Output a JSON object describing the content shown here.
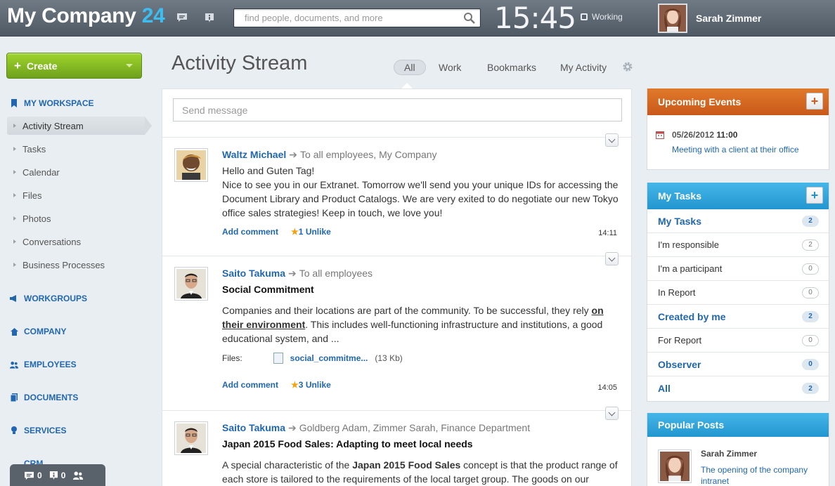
{
  "header": {
    "logo_text": "My Company",
    "logo_num": "24",
    "search_placeholder": "find people, documents, and more",
    "clock": "15:45",
    "status": "Working",
    "user_name": "Sarah Zimmer"
  },
  "sidebar": {
    "create_label": "Create",
    "my_workspace": "MY WORKSPACE",
    "items": [
      "Activity Stream",
      "Tasks",
      "Calendar",
      "Files",
      "Photos",
      "Conversations",
      "Business Processes"
    ],
    "sections": [
      "WORKGROUPS",
      "COMPANY",
      "EMPLOYEES",
      "DOCUMENTS",
      "SERVICES",
      "CRM"
    ],
    "bottom": {
      "messages": "0",
      "notifications": "0"
    }
  },
  "main": {
    "title": "Activity Stream",
    "tabs": [
      "All",
      "Work",
      "Bookmarks",
      "My Activity"
    ],
    "message_placeholder": "Send message",
    "posts": [
      {
        "author": "Waltz Michael",
        "to": "To all employees, My Company",
        "line1": "Hello and Guten Tag!",
        "line2": "Nice to see you in our Extranet. Tomorrow we'll send you your unique IDs for accessing the Document Library and Product Catalogs. We are very exited to do negotiate our new Tokyo office sales strategies! Keep in touch, we love you!",
        "add_comment": "Add comment",
        "likes": "1",
        "unlike": "Unlike",
        "time": "14:11"
      },
      {
        "author": "Saito Takuma",
        "to": "To all employees",
        "title": "Social Commitment",
        "text_a": "Companies and their locations are part of the community. To be successful, they rely ",
        "text_link": "on their environment",
        "text_b": ". This includes well-functioning infrastructure and institutions, a good educational system, and ...",
        "files_label": "Files:",
        "file_name": "social_commitme...",
        "file_size": "(13 Kb)",
        "add_comment": "Add comment",
        "likes": "3",
        "unlike": "Unlike",
        "time": "14:05"
      },
      {
        "author": "Saito Takuma",
        "to": "Goldberg Adam, Zimmer Sarah, Finance Department",
        "title": "Japan 2015 Food Sales: Adapting to meet local needs",
        "text_a": "A special characteristic of the ",
        "text_bold": "Japan 2015 Food Sales",
        "text_b": " concept is that the product range of each store is tailored to the requirements of the local target group. The goods on our"
      }
    ]
  },
  "events": {
    "title": "Upcoming Events",
    "date": "05/26/2012",
    "time": "11:00",
    "name": "Meeting with a client at their office"
  },
  "tasks": {
    "title": "My Tasks",
    "rows": [
      {
        "label": "My Tasks",
        "count": "2"
      },
      {
        "label": "I'm responsible",
        "count": "2"
      },
      {
        "label": "I'm a participant",
        "count": "0"
      },
      {
        "label": "In Report",
        "count": "0"
      },
      {
        "label": "Created by me",
        "count": "2"
      },
      {
        "label": "For Report",
        "count": "0"
      },
      {
        "label": "Observer",
        "count": "0"
      },
      {
        "label": "All",
        "count": "2"
      }
    ]
  },
  "popular": {
    "title": "Popular Posts",
    "author": "Sarah Zimmer",
    "post": "The opening of the company intranet"
  },
  "colors": {
    "accent_blue": "#2067b0",
    "logo_blue": "#3dbdf0",
    "create_green": "#7fb524",
    "orange": "#d96a22",
    "tasks_blue": "#2a9ed6"
  }
}
